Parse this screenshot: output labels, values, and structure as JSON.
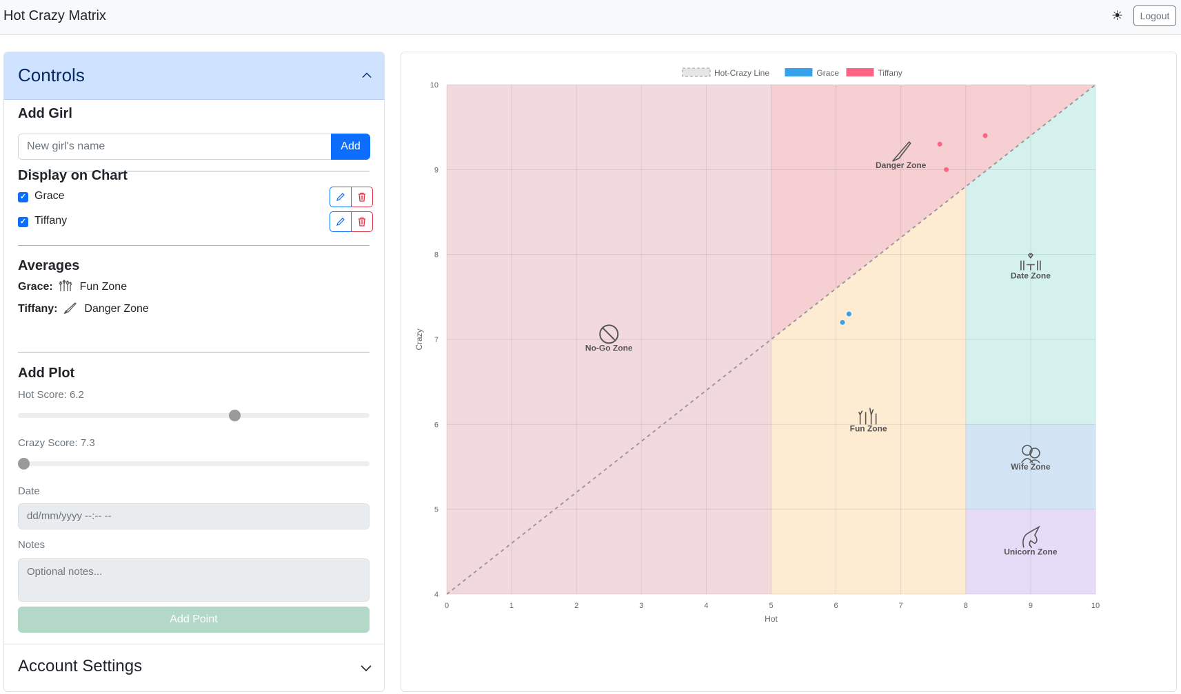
{
  "app": {
    "title": "Hot Crazy Matrix",
    "theme_icon": "☀",
    "logout_label": "Logout"
  },
  "controls": {
    "title": "Controls",
    "add_girl": {
      "heading": "Add Girl",
      "placeholder": "New girl's name",
      "button": "Add"
    },
    "display": {
      "heading": "Display on Chart",
      "girls": [
        {
          "name": "Grace",
          "checked": true
        },
        {
          "name": "Tiffany",
          "checked": true
        }
      ]
    },
    "averages": {
      "heading": "Averages",
      "items": [
        {
          "name": "Grace:",
          "zone": "Fun Zone",
          "icon": "fun-zone-icon"
        },
        {
          "name": "Tiffany:",
          "zone": "Danger Zone",
          "icon": "knife-icon"
        }
      ]
    },
    "add_plot": {
      "heading": "Add Plot",
      "hot_label": "Hot Score: 6.2",
      "hot_value": 6.2,
      "crazy_label": "Crazy Score: 7.3",
      "crazy_value": 7.3,
      "date_label": "Date",
      "date_placeholder": "dd/mm/yyyy --:-- --",
      "notes_label": "Notes",
      "notes_placeholder": "Optional notes...",
      "submit": "Add Point"
    },
    "account_settings": "Account Settings"
  },
  "chart_data": {
    "type": "scatter",
    "xlabel": "Hot",
    "ylabel": "Crazy",
    "xlim": [
      0,
      10
    ],
    "ylim": [
      4,
      10
    ],
    "x_ticks": [
      "0",
      "1",
      "2",
      "3",
      "4",
      "5",
      "6",
      "7",
      "8",
      "9",
      "10"
    ],
    "y_ticks": [
      "4",
      "5",
      "6",
      "7",
      "8",
      "9",
      "10"
    ],
    "grid": true,
    "legend": [
      {
        "name": "Hot-Crazy Line",
        "color": "#d9d9d9",
        "style": "dashed"
      },
      {
        "name": "Grace",
        "color": "#36a2eb"
      },
      {
        "name": "Tiffany",
        "color": "#ff6384"
      }
    ],
    "line": {
      "name": "Hot-Crazy Line",
      "points": [
        [
          0,
          4
        ],
        [
          10,
          10
        ]
      ]
    },
    "series": [
      {
        "name": "Grace",
        "color": "#36a2eb",
        "points": [
          [
            6.1,
            7.2
          ],
          [
            6.2,
            7.3
          ]
        ]
      },
      {
        "name": "Tiffany",
        "color": "#ff6384",
        "points": [
          [
            7.6,
            9.3
          ],
          [
            7.7,
            9.0
          ],
          [
            8.3,
            9.4
          ]
        ]
      }
    ],
    "zones": [
      {
        "name": "No-Go Zone",
        "color": "#f2d9de",
        "label_at": [
          2.5,
          6.9
        ],
        "icon": "no-go-icon"
      },
      {
        "name": "Danger Zone",
        "color": "#f6cfd2",
        "label_at": [
          7,
          9.05
        ],
        "icon": "knife-icon"
      },
      {
        "name": "Fun Zone",
        "color": "#fdebd2",
        "label_at": [
          6.5,
          5.95
        ],
        "icon": "fun-zone-icon"
      },
      {
        "name": "Date Zone",
        "color": "#d4f1ee",
        "label_at": [
          9,
          7.75
        ],
        "icon": "date-zone-icon"
      },
      {
        "name": "Wife Zone",
        "color": "#d3e4f5",
        "label_at": [
          9,
          5.5
        ],
        "icon": "wife-zone-icon"
      },
      {
        "name": "Unicorn Zone",
        "color": "#e6dcf7",
        "label_at": [
          9,
          4.5
        ],
        "icon": "unicorn-icon"
      }
    ]
  }
}
